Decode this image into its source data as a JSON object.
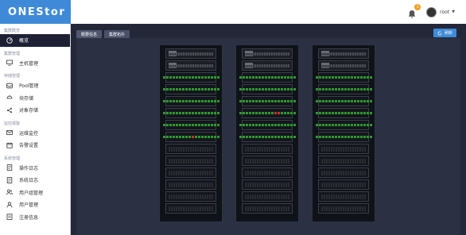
{
  "app": {
    "logo": "ONEStor"
  },
  "header": {
    "username": "root",
    "badge": "1"
  },
  "sidebar": {
    "groups": [
      {
        "label": "集群概览",
        "items": [
          {
            "label": "概览",
            "icon": "dashboard-icon",
            "active": true
          }
        ]
      },
      {
        "label": "集群管理",
        "items": [
          {
            "label": "主机管理",
            "icon": "monitor-icon"
          }
        ]
      },
      {
        "label": "存储管理",
        "items": [
          {
            "label": "Pool管理",
            "icon": "pool-icon"
          },
          {
            "label": "块存储",
            "icon": "block-storage-icon"
          },
          {
            "label": "对象存储",
            "icon": "share-icon"
          }
        ]
      },
      {
        "label": "监控报警",
        "items": [
          {
            "label": "运维监控",
            "icon": "mail-icon"
          },
          {
            "label": "告警设置",
            "icon": "calendar-icon"
          }
        ]
      },
      {
        "label": "系统管理",
        "items": [
          {
            "label": "操作日志",
            "icon": "document-icon"
          },
          {
            "label": "系统日志",
            "icon": "document-icon"
          },
          {
            "label": "用户组管理",
            "icon": "user-group-icon"
          },
          {
            "label": "用户管理",
            "icon": "user-icon"
          },
          {
            "label": "注册信息",
            "icon": "register-icon"
          }
        ]
      }
    ]
  },
  "main": {
    "tabs": [
      {
        "label": "概要信息",
        "active": false
      },
      {
        "label": "集群拓扑",
        "active": true
      }
    ],
    "refresh_label": "刷新"
  },
  "colors": {
    "brand": "#3f8ad8",
    "sidebar_active": "#1d2133",
    "led_green": "#2d9a2d",
    "led_red": "#c83030"
  }
}
